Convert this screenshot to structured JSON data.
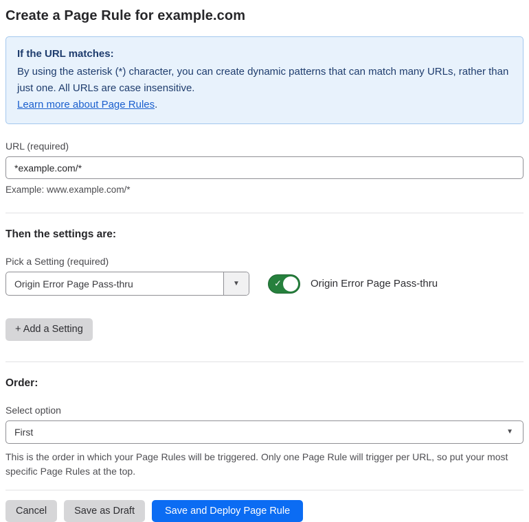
{
  "page": {
    "title": "Create a Page Rule for example.com"
  },
  "callout": {
    "heading": "If the URL matches:",
    "body": "By using the asterisk (*) character, you can create dynamic patterns that can match many URLs, rather than just one. All URLs are case insensitive.",
    "link_label": "Learn more about Page Rules",
    "link_suffix": "."
  },
  "url_field": {
    "label": "URL (required)",
    "value": "*example.com/*",
    "helper": "Example: www.example.com/*"
  },
  "settings_section": {
    "heading": "Then the settings are:",
    "picker_label": "Pick a Setting (required)",
    "picker_value": "Origin Error Page Pass-thru",
    "toggle_label": "Origin Error Page Pass-thru",
    "toggle_state": "on",
    "toggle_check_glyph": "✓",
    "add_button_label": "+ Add a Setting"
  },
  "order_section": {
    "heading": "Order:",
    "select_label": "Select option",
    "select_value": "First",
    "helper": "This is the order in which your Page Rules will be triggered. Only one Page Rule will trigger per URL, so put your most specific Page Rules at the top."
  },
  "footer": {
    "cancel_label": "Cancel",
    "save_draft_label": "Save as Draft",
    "save_deploy_label": "Save and Deploy Page Rule"
  },
  "icons": {
    "dropdown_caret": "▼"
  },
  "colors": {
    "accent_blue": "#0b6cf3",
    "toggle_green": "#26803d",
    "callout_bg": "#e8f2fc",
    "callout_border": "#a3c7ee",
    "callout_text": "#1e3c6d",
    "link_blue": "#1a5fce",
    "button_gray": "#d6d6d8"
  }
}
